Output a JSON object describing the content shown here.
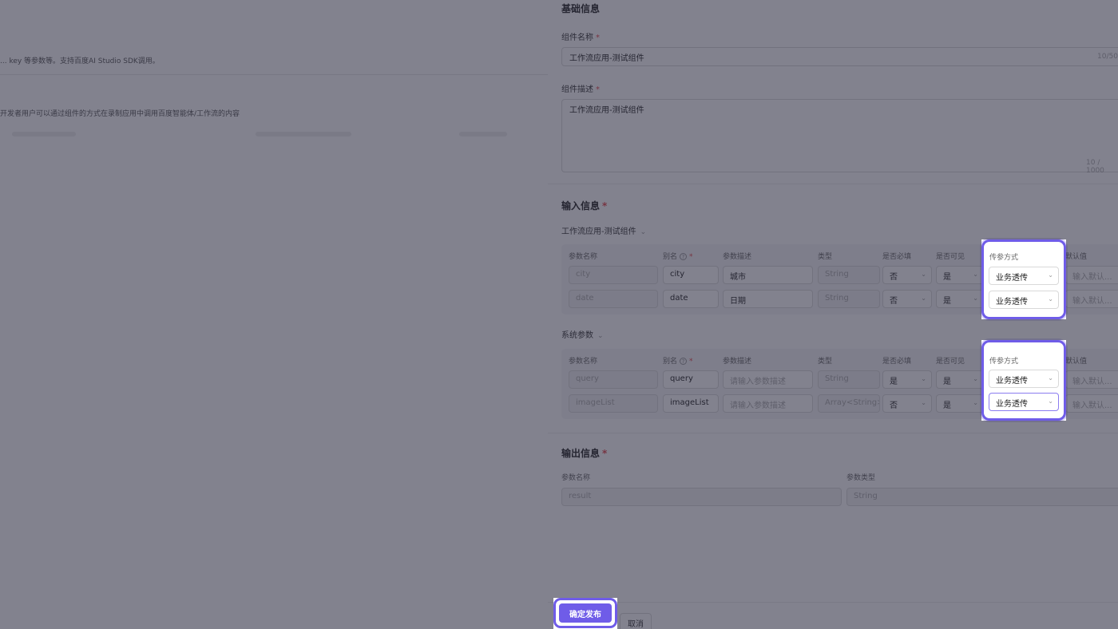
{
  "background_page": {
    "line1": "... key 等参数等。支持百度AI Studio SDK调用。",
    "line2": "开发者用户可以通过组件的方式在录制应用中调用百度智能体/工作流的内容"
  },
  "basic": {
    "section_title": "基础信息",
    "name_label": "组件名称",
    "name_value": "工作流应用-测试组件",
    "name_counter": "10/50",
    "desc_label": "组件描述",
    "desc_value": "工作流应用-测试组件",
    "desc_counter": "10 / 1000"
  },
  "input": {
    "section_title": "输入信息",
    "group1_title": "工作流应用-测试组件",
    "group2_title": "系统参数",
    "headers": {
      "param_name": "参数名称",
      "alias": "别名",
      "param_desc": "参数描述",
      "type": "类型",
      "required": "是否必填",
      "visible": "是否可见",
      "pass_mode": "传参方式",
      "default": "默认值"
    },
    "group1_rows": [
      {
        "name": "city",
        "alias": "city",
        "desc": "城市",
        "type": "String",
        "required": "否",
        "visible": "是",
        "pass_mode": "业务透传",
        "default_ph": "输入默认..."
      },
      {
        "name": "date",
        "alias": "date",
        "desc": "日期",
        "type": "String",
        "required": "否",
        "visible": "是",
        "pass_mode": "业务透传",
        "default_ph": "输入默认..."
      }
    ],
    "group2_rows": [
      {
        "name": "query",
        "alias": "query",
        "desc_ph": "请输入参数描述",
        "type": "String",
        "required": "是",
        "visible": "是",
        "pass_mode": "业务透传",
        "default_ph": "输入默认..."
      },
      {
        "name": "imageList",
        "alias": "imageList",
        "desc_ph": "请输入参数描述",
        "type": "Array<String>",
        "required": "否",
        "visible": "是",
        "pass_mode": "业务透传",
        "default_ph": "输入默认..."
      }
    ]
  },
  "output": {
    "section_title": "输出信息",
    "name_label": "参数名称",
    "type_label": "参数类型",
    "name_value": "result",
    "type_value": "String"
  },
  "footer": {
    "publish": "确定发布",
    "cancel": "取消"
  },
  "colors": {
    "accent": "#6f5ce8",
    "required": "#e5484d"
  }
}
